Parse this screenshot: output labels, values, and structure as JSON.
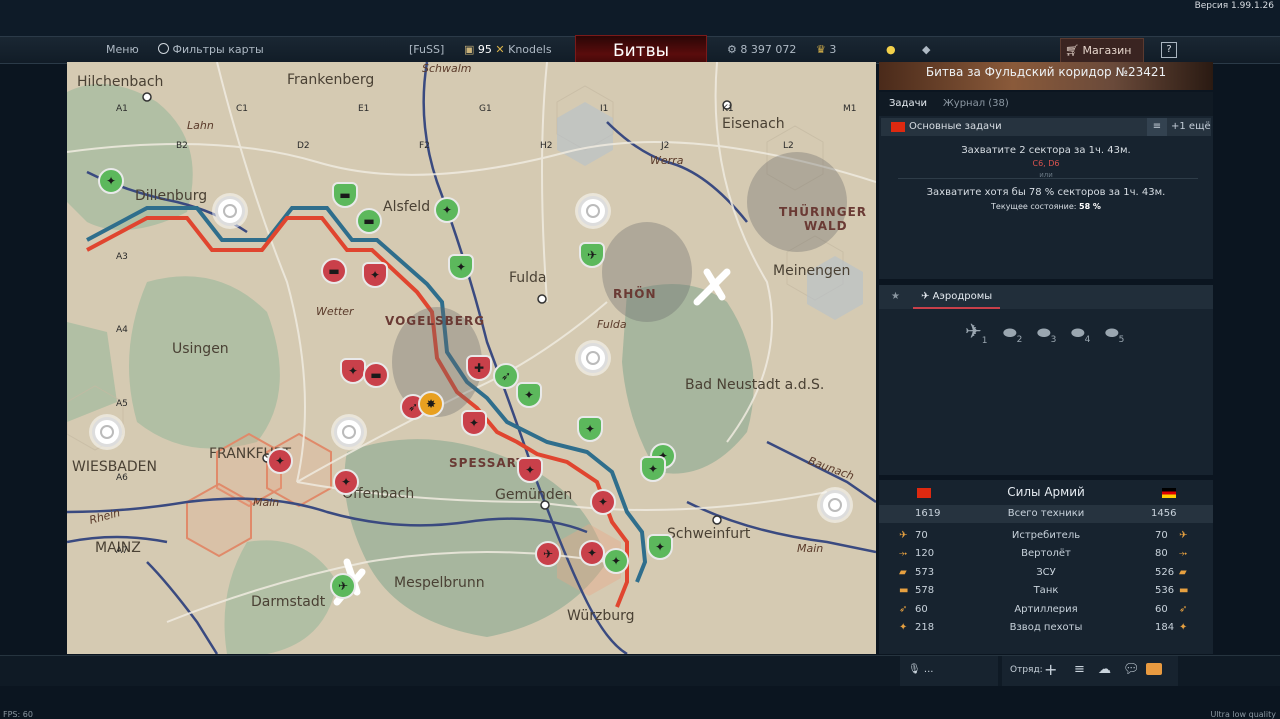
{
  "app": {
    "version": "Версия 1.99.1.26"
  },
  "nav": {
    "menu": "Меню",
    "map_filters": "Фильтры карты",
    "squad_tag": "[FuSS]",
    "player_level": "95",
    "player_name": "Knodels",
    "battles": "Битвы",
    "silver": "8 397 072",
    "eagles": "3",
    "shop": "Магазин",
    "help": "?"
  },
  "battle": {
    "title": "Битва за Фульдский коридор №23421",
    "tabs": [
      "Задачи",
      "Журнал (38)"
    ],
    "objectives_header": "Основные задачи",
    "more": "+1 ещё",
    "objective1": "Захватите 2 сектора за 1ч. 43м.",
    "objective1_sectors": "C6, D6",
    "or": "или",
    "objective2": "Захватите хотя бы 78 % секторов за 1ч. 43м.",
    "current_state_label": "Текущее состояние:",
    "current_state_value": "58 %"
  },
  "airfields": {
    "title": "Аэродромы",
    "numbers": [
      "1",
      "2",
      "3",
      "4",
      "5"
    ]
  },
  "forces": {
    "title": "Силы Армий",
    "total_label": "Всего техники",
    "total_left": "1619",
    "total_right": "1456",
    "rows": [
      {
        "name": "Истребитель",
        "left": "70",
        "right": "70",
        "icon": "fighter-icon"
      },
      {
        "name": "Вертолёт",
        "left": "120",
        "right": "80",
        "icon": "helicopter-icon"
      },
      {
        "name": "ЗСУ",
        "left": "573",
        "right": "526",
        "icon": "spaa-icon"
      },
      {
        "name": "Танк",
        "left": "578",
        "right": "536",
        "icon": "tank-icon"
      },
      {
        "name": "Артиллерия",
        "left": "60",
        "right": "60",
        "icon": "artillery-icon"
      },
      {
        "name": "Взвод пехоты",
        "left": "218",
        "right": "184",
        "icon": "infantry-icon"
      }
    ],
    "colors": {
      "left_flag": "#de2910",
      "right_flag_black": "#000000",
      "right_flag_red": "#dd0000",
      "right_flag_gold": "#ffce00"
    }
  },
  "bottom": {
    "mic": "...",
    "squad": "Отряд:"
  },
  "footer": {
    "fps": "FPS: 60",
    "quality": "Ultra low quality"
  },
  "map": {
    "cities": [
      "Hilchenbach",
      "Frankenberg",
      "Schwalm",
      "Eisenach",
      "Dillenburg",
      "Alsfeld",
      "Werra",
      "Meinengen",
      "Wetter",
      "Fulda",
      "Usingen",
      "Fulda",
      "Bad Neustadt a.d.S.",
      "WIESBADEN",
      "FRANKFURT",
      "Offenbach",
      "Gemünden",
      "Schweinfurt",
      "Baunach",
      "Rhein",
      "Main",
      "MAINZ",
      "Main",
      "Darmstadt",
      "Mespelbrunn",
      "Würzburg",
      "Lahn"
    ],
    "regions": [
      "VOGELSBERG",
      "RHÖN",
      "THÜRINGER",
      "WALD",
      "SPESSART"
    ],
    "grid_cols": [
      "A1",
      "C1",
      "E1",
      "G1",
      "I1",
      "K1",
      "M1",
      "B2",
      "D2",
      "F2",
      "H2",
      "J2",
      "L2"
    ],
    "grid_rows": [
      "A3",
      "A4",
      "A5",
      "A6",
      "A7"
    ],
    "colors": {
      "blue_front": "#2f6e8c",
      "red_front": "#e0452f",
      "forest": "#9fb39a",
      "hex": "#b6c2cc"
    }
  }
}
